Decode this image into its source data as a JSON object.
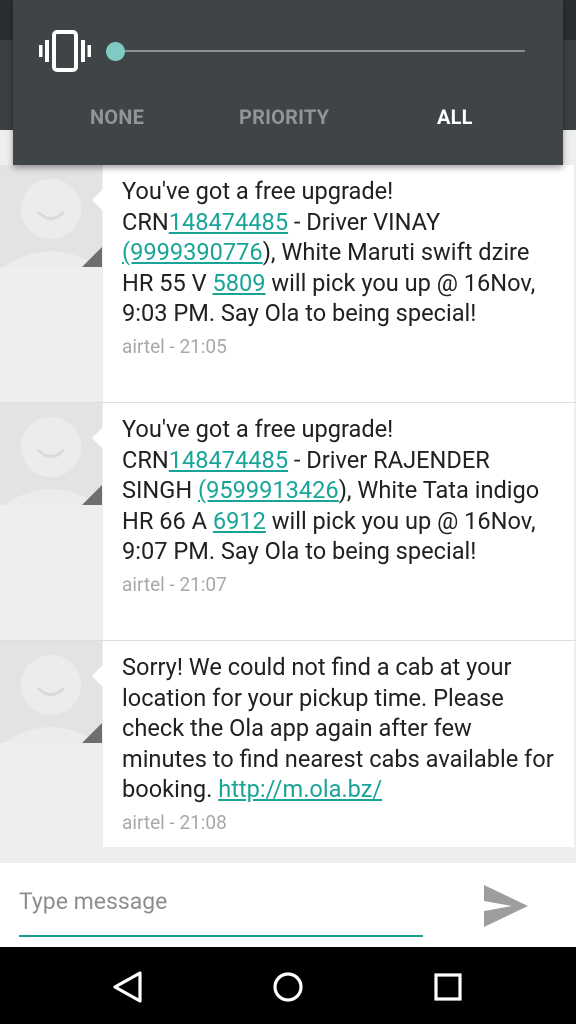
{
  "volume_panel": {
    "level": 0.0,
    "modes": [
      "NONE",
      "PRIORITY",
      "ALL"
    ],
    "active_mode": "ALL",
    "mode_icon": "vibrate-icon"
  },
  "messages": [
    {
      "segments": [
        {
          "text": "You've got a free upgrade! CRN"
        },
        {
          "text": "148474485",
          "link": true
        },
        {
          "text": " - Driver VINAY "
        },
        {
          "text": "(9999390776",
          "link": true
        },
        {
          "text": "), White Maruti swift dzire HR 55 V "
        },
        {
          "text": "5809",
          "link": true
        },
        {
          "text": "  will pick you up @ 16Nov, 9:03 PM. Say Ola to being special!"
        }
      ],
      "meta": "airtel - 21:05"
    },
    {
      "segments": [
        {
          "text": "You've got a free upgrade! CRN"
        },
        {
          "text": "148474485",
          "link": true
        },
        {
          "text": " - Driver RAJENDER SINGH  "
        },
        {
          "text": "(9599913426",
          "link": true
        },
        {
          "text": "), White Tata indigo HR 66 A "
        },
        {
          "text": "6912",
          "link": true
        },
        {
          "text": "  will pick you up @ 16Nov, 9:07 PM. Say Ola to being special!"
        }
      ],
      "meta": "airtel - 21:07"
    },
    {
      "segments": [
        {
          "text": "Sorry! We could not find a cab at your location for your pickup time. Please check the Ola app again after few minutes to find nearest cabs available for booking. "
        },
        {
          "text": "http://m.ola.bz/",
          "link": true
        }
      ],
      "meta": "airtel - 21:08"
    }
  ],
  "composer": {
    "placeholder": "Type message",
    "value": "",
    "send_icon": "send-icon"
  },
  "navbar": {
    "icons": [
      "back-icon",
      "home-icon",
      "recents-icon"
    ]
  },
  "colors": {
    "accent": "#18a597",
    "panel": "#3f4447",
    "link": "#18a597"
  }
}
